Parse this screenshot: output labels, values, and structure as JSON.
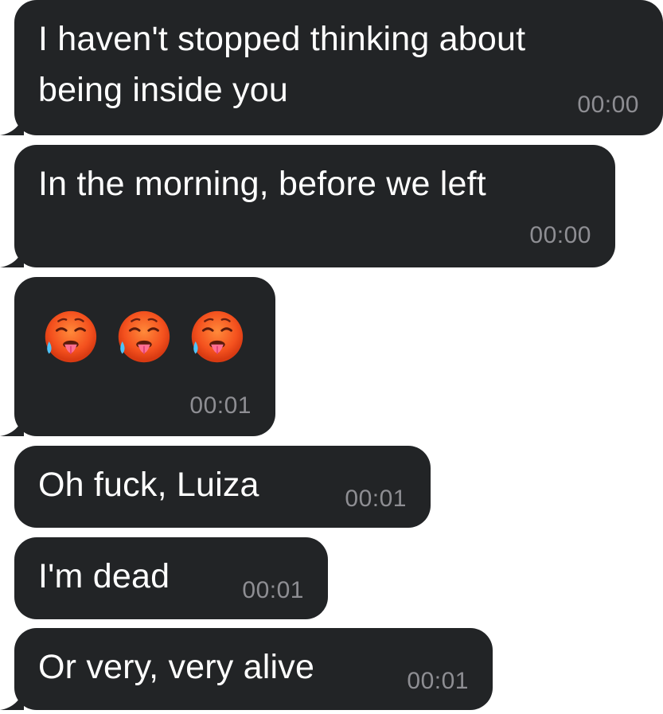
{
  "messages": [
    {
      "text": "I haven't stopped thinking about\nbeing inside you",
      "time": "00:00"
    },
    {
      "text": "In the morning, before we left",
      "time": "00:00"
    },
    {
      "emoji": [
        "hot-face-emoji",
        "hot-face-emoji",
        "hot-face-emoji"
      ],
      "time": "00:01"
    },
    {
      "text": "Oh fuck, Luiza",
      "time": "00:01"
    },
    {
      "text": "I'm dead",
      "time": "00:01"
    },
    {
      "text": "Or very, very alive",
      "time": "00:01"
    }
  ],
  "colors": {
    "bubble": "#222426",
    "text": "#ffffff",
    "timestamp": "#8e8e93",
    "background": "#ffffff"
  }
}
